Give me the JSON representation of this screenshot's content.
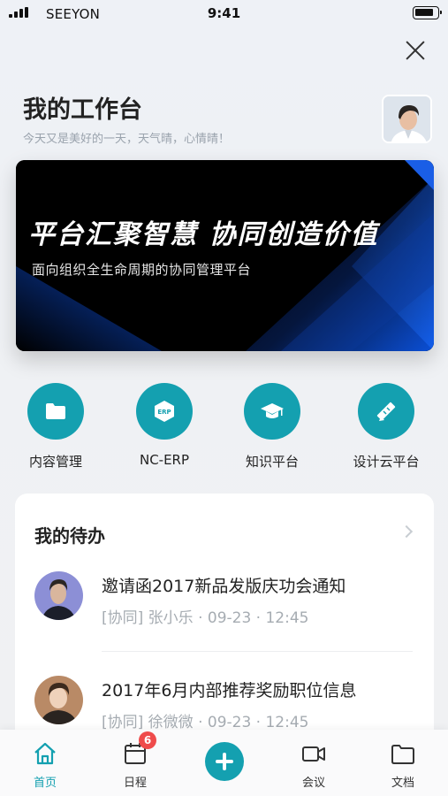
{
  "status_bar": {
    "carrier": "SEEYON",
    "time": "9:41"
  },
  "header": {
    "title": "我的工作台",
    "subtitle": "今天又是美好的一天，天气晴，心情晴！"
  },
  "banner": {
    "headline": "平台汇聚智慧 协同创造价值",
    "subline": "面向组织全生命周期的协同管理平台"
  },
  "apps": [
    {
      "label": "内容管理",
      "icon": "folder-icon"
    },
    {
      "label": "NC-ERP",
      "icon": "erp-icon"
    },
    {
      "label": "知识平台",
      "icon": "graduation-cap-icon"
    },
    {
      "label": "设计云平台",
      "icon": "ruler-pencil-icon"
    }
  ],
  "todo": {
    "title": "我的待办",
    "items": [
      {
        "title": "邀请函2017新品发版庆功会通知",
        "meta": "[协同] 张小乐 · 09-23 · 12:45"
      },
      {
        "title": "2017年6月内部推荐奖励职位信息",
        "meta": "[协同] 徐微微 · 09-23 · 12:45"
      }
    ]
  },
  "tabbar": {
    "tabs": [
      {
        "label": "首页",
        "icon": "home-icon"
      },
      {
        "label": "日程",
        "icon": "calendar-icon",
        "badge": "6"
      },
      {
        "label": "",
        "icon": "plus-icon"
      },
      {
        "label": "会议",
        "icon": "video-icon"
      },
      {
        "label": "文档",
        "icon": "folder-icon"
      }
    ],
    "active_color": "#14a0b0"
  },
  "colors": {
    "accent": "#14a0b0",
    "badge": "#ef4b4b"
  }
}
